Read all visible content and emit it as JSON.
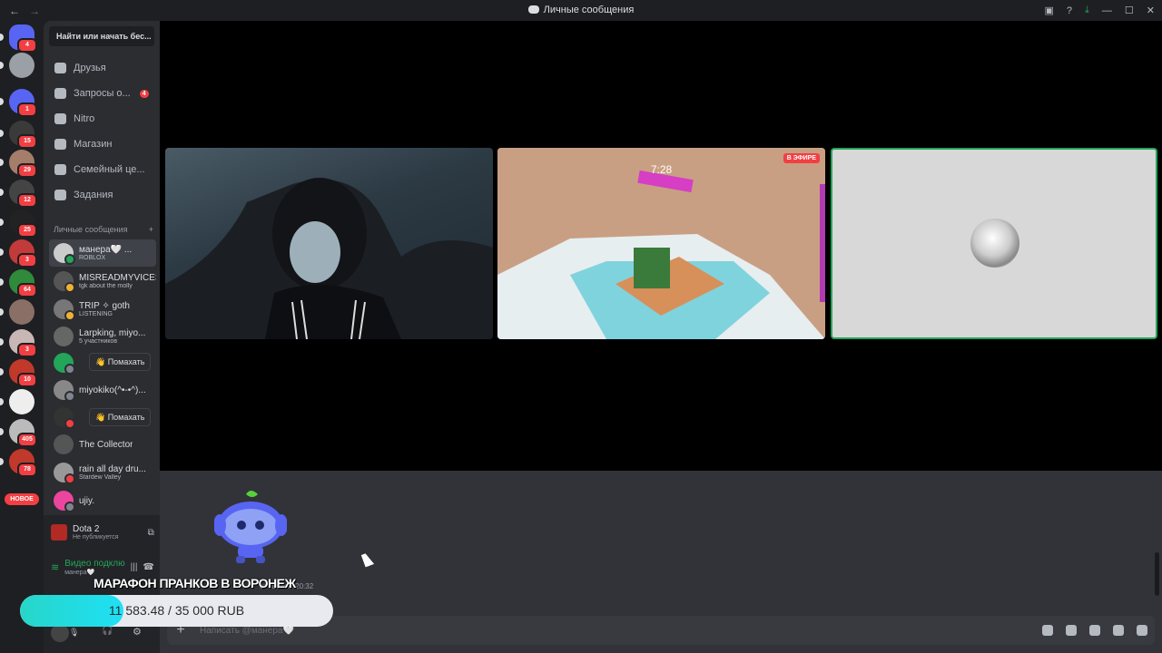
{
  "window": {
    "title": "Личные сообщения"
  },
  "servers": [
    {
      "name": "discord-home",
      "badge": "4",
      "color": "#5865f2"
    },
    {
      "name": "server-2",
      "badge": "",
      "color": "#9aa0a6"
    },
    {
      "name": "server-3",
      "badge": "1",
      "color": "#5865f2"
    },
    {
      "name": "server-4",
      "badge": "15",
      "color": "#3a3a3a"
    },
    {
      "name": "server-5",
      "badge": "29",
      "color": "#a47d6b"
    },
    {
      "name": "server-6",
      "badge": "12",
      "color": "#444"
    },
    {
      "name": "server-7",
      "badge": "25",
      "color": "#222"
    },
    {
      "name": "server-8",
      "badge": "3",
      "color": "#c23a3a"
    },
    {
      "name": "server-9",
      "badge": "64",
      "color": "#2f8a3c"
    },
    {
      "name": "server-10",
      "badge": "",
      "color": "#8a6f66"
    },
    {
      "name": "server-11",
      "badge": "3",
      "color": "#c9b7b5"
    },
    {
      "name": "server-12",
      "badge": "10",
      "color": "#c0392b"
    },
    {
      "name": "server-13",
      "badge": "",
      "color": "#eee"
    },
    {
      "name": "server-14",
      "badge": "405",
      "color": "#bbb"
    },
    {
      "name": "server-15",
      "badge": "78",
      "color": "#c0392b"
    }
  ],
  "new_badge": "НОВОЕ",
  "search": {
    "placeholder": "Найти или начать бес..."
  },
  "nav": [
    {
      "label": "Друзья",
      "icon": "friends-icon",
      "count": ""
    },
    {
      "label": "Запросы о...",
      "icon": "mail-icon",
      "count": "4"
    },
    {
      "label": "Nitro",
      "icon": "nitro-icon",
      "count": ""
    },
    {
      "label": "Магазин",
      "icon": "shop-icon",
      "count": ""
    },
    {
      "label": "Семейный це...",
      "icon": "family-icon",
      "count": ""
    },
    {
      "label": "Задания",
      "icon": "quests-icon",
      "count": ""
    }
  ],
  "dm_header": {
    "label": "Личные сообщения",
    "add": "+"
  },
  "dms": [
    {
      "name": "манера🤍 ...",
      "sub": "ROBLOX",
      "status": "#23a55a",
      "color": "#ccc",
      "active": true
    },
    {
      "name": "MISREADMYVICES...",
      "sub": "tgk about the molly",
      "status": "#f0b232",
      "color": "#555"
    },
    {
      "name": "TRIP  ✧ goth",
      "sub": "LISTENING",
      "status": "#f0b232",
      "color": "#777"
    },
    {
      "name": "Larpking, miyo...",
      "sub": "5 участников",
      "status": "",
      "color": "#666"
    },
    {
      "name": "",
      "sub": "",
      "status": "#80848e",
      "color": "#23a55a"
    },
    {
      "name": "miyokiko(^•-•^)...",
      "sub": "",
      "status": "#80848e",
      "color": "#888"
    },
    {
      "name": "",
      "sub": "",
      "status": "#f23f43",
      "color": "#333"
    },
    {
      "name": "The Collector",
      "sub": "",
      "status": "",
      "color": "#555"
    },
    {
      "name": "rain all day dru...",
      "sub": "Stardew Valley",
      "status": "#f23f43",
      "color": "#999"
    },
    {
      "name": "ujiy.",
      "sub": "",
      "status": "#80848e",
      "color": "#eb459e"
    }
  ],
  "wave_label": "👋 Помахать",
  "activity": {
    "game": "Dota 2",
    "game_sub": "Не публикуется",
    "voice": "Видео подклю",
    "voice_sub": "манера🤍"
  },
  "call": {
    "live": "В ЭФИРЕ",
    "timer": "7:28"
  },
  "chat": {
    "sys_line": "ет звонок. 20:32",
    "composer_placeholder": "Написать @манера🤍"
  },
  "overlay": {
    "title": "МАРАФОН ПРАНКОВ В ВОРОНЕЖ",
    "progress_text": "11 583.48 / 35 000 RUB",
    "progress_fraction": 0.331
  }
}
